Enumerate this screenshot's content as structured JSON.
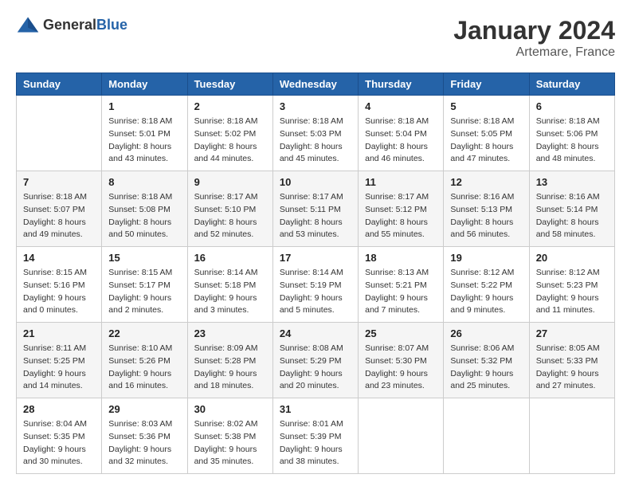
{
  "header": {
    "logo_general": "General",
    "logo_blue": "Blue",
    "month_title": "January 2024",
    "location": "Artemare, France"
  },
  "columns": [
    "Sunday",
    "Monday",
    "Tuesday",
    "Wednesday",
    "Thursday",
    "Friday",
    "Saturday"
  ],
  "weeks": [
    [
      {
        "day": "",
        "sunrise": "",
        "sunset": "",
        "daylight": ""
      },
      {
        "day": "1",
        "sunrise": "Sunrise: 8:18 AM",
        "sunset": "Sunset: 5:01 PM",
        "daylight": "Daylight: 8 hours and 43 minutes."
      },
      {
        "day": "2",
        "sunrise": "Sunrise: 8:18 AM",
        "sunset": "Sunset: 5:02 PM",
        "daylight": "Daylight: 8 hours and 44 minutes."
      },
      {
        "day": "3",
        "sunrise": "Sunrise: 8:18 AM",
        "sunset": "Sunset: 5:03 PM",
        "daylight": "Daylight: 8 hours and 45 minutes."
      },
      {
        "day": "4",
        "sunrise": "Sunrise: 8:18 AM",
        "sunset": "Sunset: 5:04 PM",
        "daylight": "Daylight: 8 hours and 46 minutes."
      },
      {
        "day": "5",
        "sunrise": "Sunrise: 8:18 AM",
        "sunset": "Sunset: 5:05 PM",
        "daylight": "Daylight: 8 hours and 47 minutes."
      },
      {
        "day": "6",
        "sunrise": "Sunrise: 8:18 AM",
        "sunset": "Sunset: 5:06 PM",
        "daylight": "Daylight: 8 hours and 48 minutes."
      }
    ],
    [
      {
        "day": "7",
        "sunrise": "Sunrise: 8:18 AM",
        "sunset": "Sunset: 5:07 PM",
        "daylight": "Daylight: 8 hours and 49 minutes."
      },
      {
        "day": "8",
        "sunrise": "Sunrise: 8:18 AM",
        "sunset": "Sunset: 5:08 PM",
        "daylight": "Daylight: 8 hours and 50 minutes."
      },
      {
        "day": "9",
        "sunrise": "Sunrise: 8:17 AM",
        "sunset": "Sunset: 5:10 PM",
        "daylight": "Daylight: 8 hours and 52 minutes."
      },
      {
        "day": "10",
        "sunrise": "Sunrise: 8:17 AM",
        "sunset": "Sunset: 5:11 PM",
        "daylight": "Daylight: 8 hours and 53 minutes."
      },
      {
        "day": "11",
        "sunrise": "Sunrise: 8:17 AM",
        "sunset": "Sunset: 5:12 PM",
        "daylight": "Daylight: 8 hours and 55 minutes."
      },
      {
        "day": "12",
        "sunrise": "Sunrise: 8:16 AM",
        "sunset": "Sunset: 5:13 PM",
        "daylight": "Daylight: 8 hours and 56 minutes."
      },
      {
        "day": "13",
        "sunrise": "Sunrise: 8:16 AM",
        "sunset": "Sunset: 5:14 PM",
        "daylight": "Daylight: 8 hours and 58 minutes."
      }
    ],
    [
      {
        "day": "14",
        "sunrise": "Sunrise: 8:15 AM",
        "sunset": "Sunset: 5:16 PM",
        "daylight": "Daylight: 9 hours and 0 minutes."
      },
      {
        "day": "15",
        "sunrise": "Sunrise: 8:15 AM",
        "sunset": "Sunset: 5:17 PM",
        "daylight": "Daylight: 9 hours and 2 minutes."
      },
      {
        "day": "16",
        "sunrise": "Sunrise: 8:14 AM",
        "sunset": "Sunset: 5:18 PM",
        "daylight": "Daylight: 9 hours and 3 minutes."
      },
      {
        "day": "17",
        "sunrise": "Sunrise: 8:14 AM",
        "sunset": "Sunset: 5:19 PM",
        "daylight": "Daylight: 9 hours and 5 minutes."
      },
      {
        "day": "18",
        "sunrise": "Sunrise: 8:13 AM",
        "sunset": "Sunset: 5:21 PM",
        "daylight": "Daylight: 9 hours and 7 minutes."
      },
      {
        "day": "19",
        "sunrise": "Sunrise: 8:12 AM",
        "sunset": "Sunset: 5:22 PM",
        "daylight": "Daylight: 9 hours and 9 minutes."
      },
      {
        "day": "20",
        "sunrise": "Sunrise: 8:12 AM",
        "sunset": "Sunset: 5:23 PM",
        "daylight": "Daylight: 9 hours and 11 minutes."
      }
    ],
    [
      {
        "day": "21",
        "sunrise": "Sunrise: 8:11 AM",
        "sunset": "Sunset: 5:25 PM",
        "daylight": "Daylight: 9 hours and 14 minutes."
      },
      {
        "day": "22",
        "sunrise": "Sunrise: 8:10 AM",
        "sunset": "Sunset: 5:26 PM",
        "daylight": "Daylight: 9 hours and 16 minutes."
      },
      {
        "day": "23",
        "sunrise": "Sunrise: 8:09 AM",
        "sunset": "Sunset: 5:28 PM",
        "daylight": "Daylight: 9 hours and 18 minutes."
      },
      {
        "day": "24",
        "sunrise": "Sunrise: 8:08 AM",
        "sunset": "Sunset: 5:29 PM",
        "daylight": "Daylight: 9 hours and 20 minutes."
      },
      {
        "day": "25",
        "sunrise": "Sunrise: 8:07 AM",
        "sunset": "Sunset: 5:30 PM",
        "daylight": "Daylight: 9 hours and 23 minutes."
      },
      {
        "day": "26",
        "sunrise": "Sunrise: 8:06 AM",
        "sunset": "Sunset: 5:32 PM",
        "daylight": "Daylight: 9 hours and 25 minutes."
      },
      {
        "day": "27",
        "sunrise": "Sunrise: 8:05 AM",
        "sunset": "Sunset: 5:33 PM",
        "daylight": "Daylight: 9 hours and 27 minutes."
      }
    ],
    [
      {
        "day": "28",
        "sunrise": "Sunrise: 8:04 AM",
        "sunset": "Sunset: 5:35 PM",
        "daylight": "Daylight: 9 hours and 30 minutes."
      },
      {
        "day": "29",
        "sunrise": "Sunrise: 8:03 AM",
        "sunset": "Sunset: 5:36 PM",
        "daylight": "Daylight: 9 hours and 32 minutes."
      },
      {
        "day": "30",
        "sunrise": "Sunrise: 8:02 AM",
        "sunset": "Sunset: 5:38 PM",
        "daylight": "Daylight: 9 hours and 35 minutes."
      },
      {
        "day": "31",
        "sunrise": "Sunrise: 8:01 AM",
        "sunset": "Sunset: 5:39 PM",
        "daylight": "Daylight: 9 hours and 38 minutes."
      },
      {
        "day": "",
        "sunrise": "",
        "sunset": "",
        "daylight": ""
      },
      {
        "day": "",
        "sunrise": "",
        "sunset": "",
        "daylight": ""
      },
      {
        "day": "",
        "sunrise": "",
        "sunset": "",
        "daylight": ""
      }
    ]
  ]
}
